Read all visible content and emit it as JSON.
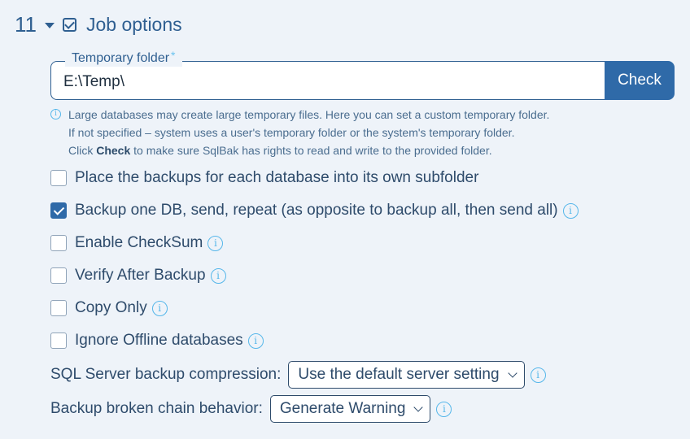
{
  "section": {
    "number": "11",
    "title": "Job options"
  },
  "temp_folder": {
    "label": "Temporary folder",
    "required_mark": "*",
    "value": "E:\\Temp\\",
    "check_button": "Check",
    "hint": {
      "line1": "Large databases may create large temporary files. Here you can set a custom temporary folder.",
      "line2": "If not specified – system uses a user's temporary folder or the system's temporary folder.",
      "line3_prefix": "Click ",
      "line3_bold": "Check",
      "line3_suffix": " to make sure SqlBak has rights to read and write to the provided folder."
    }
  },
  "options": [
    {
      "label": "Place the backups for each database into its own subfolder",
      "checked": false,
      "info": false
    },
    {
      "label": "Backup one DB, send, repeat (as opposite to backup all, then send all)",
      "checked": true,
      "info": true
    },
    {
      "label": "Enable CheckSum",
      "checked": false,
      "info": true
    },
    {
      "label": "Verify After Backup",
      "checked": false,
      "info": true
    },
    {
      "label": "Copy Only",
      "checked": false,
      "info": true
    },
    {
      "label": "Ignore Offline databases",
      "checked": false,
      "info": true
    }
  ],
  "compression": {
    "label": "SQL Server backup compression:",
    "selected": "Use the default server setting"
  },
  "broken_chain": {
    "label": "Backup broken chain behavior:",
    "selected": "Generate Warning"
  },
  "icons": {
    "info_glyph": "i"
  },
  "colors": {
    "accent": "#2f6aa8",
    "info": "#56b7ea",
    "text": "#2e4b6b",
    "background": "#eef3f9"
  }
}
